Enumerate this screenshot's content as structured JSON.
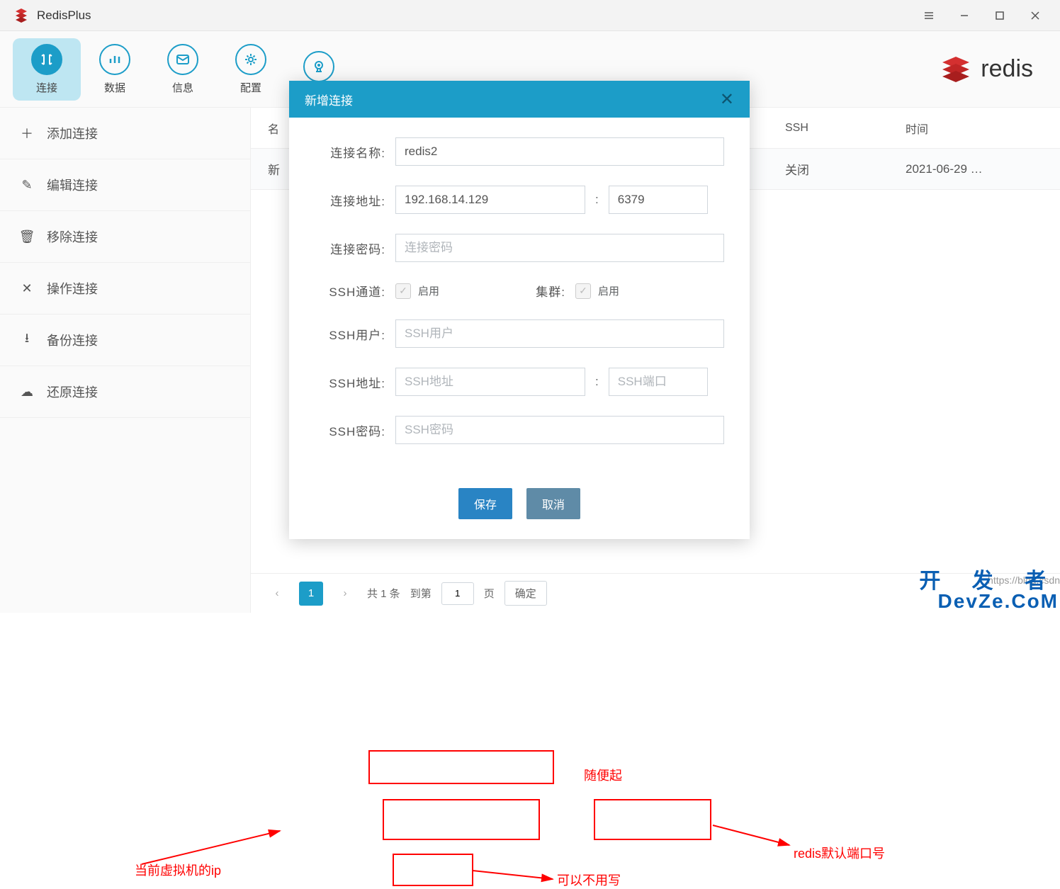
{
  "titlebar": {
    "title": "RedisPlus"
  },
  "toolbar": {
    "items": [
      {
        "label": "连接"
      },
      {
        "label": "数据"
      },
      {
        "label": "信息"
      },
      {
        "label": "配置"
      },
      {
        "label": ""
      }
    ],
    "redis_text": "redis"
  },
  "sidebar": {
    "items": [
      {
        "label": "添加连接"
      },
      {
        "label": "编辑连接"
      },
      {
        "label": "移除连接"
      },
      {
        "label": "操作连接"
      },
      {
        "label": "备份连接"
      },
      {
        "label": "还原连接"
      }
    ]
  },
  "table": {
    "headers": {
      "name": "名",
      "ssh": "SSH",
      "time": "时间"
    },
    "rows": [
      {
        "name": "新",
        "ssh": "关闭",
        "time": "2021-06-29 …"
      }
    ]
  },
  "pagination": {
    "current": "1",
    "total_text": "共 1 条",
    "goto_text": "到第",
    "page_input": "1",
    "page_suffix": "页",
    "confirm": "确定"
  },
  "dialog": {
    "title": "新增连接",
    "labels": {
      "name": "连接名称:",
      "addr": "连接地址:",
      "password": "连接密码:",
      "ssh_tunnel": "SSH通道:",
      "cluster": "集群:",
      "ssh_user": "SSH用户:",
      "ssh_addr": "SSH地址:",
      "ssh_password": "SSH密码:"
    },
    "values": {
      "name": "redis2",
      "addr": "192.168.14.129",
      "port": "6379",
      "colon": ":"
    },
    "placeholders": {
      "password": "连接密码",
      "ssh_user": "SSH用户",
      "ssh_addr": "SSH地址",
      "ssh_port": "SSH端口",
      "ssh_password": "SSH密码"
    },
    "enable": "启用",
    "save": "保存",
    "cancel": "取消"
  },
  "annotations": {
    "ip": "当前虚拟机的ip",
    "name_hint": "随便起",
    "port_hint": "redis默认端口号",
    "password_hint": "可以不用写"
  },
  "watermarks": {
    "url": "https://blog.csdn",
    "brand1": "开 发 者",
    "brand2": "DevZe.CoM"
  }
}
